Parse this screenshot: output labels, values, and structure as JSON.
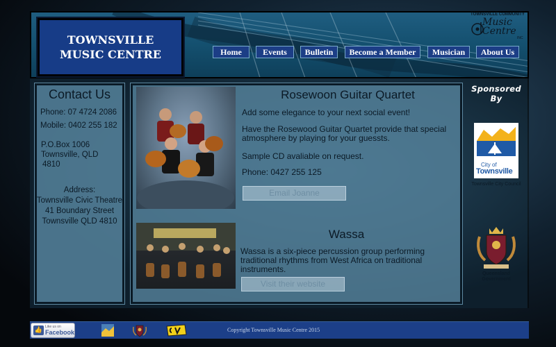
{
  "brand": {
    "site_title": "TOWNSVILLE MUSIC CENTRE",
    "logo_top": "TOWNSVILLE COMMUNITY",
    "logo_script_1": "Music",
    "logo_script_2": "Centre",
    "logo_inc": "INC"
  },
  "nav": {
    "items": [
      {
        "label": "Home"
      },
      {
        "label": "Events"
      },
      {
        "label": "Bulletin"
      },
      {
        "label": "Become a Member"
      },
      {
        "label": "Musician"
      },
      {
        "label": "About Us"
      }
    ]
  },
  "contact": {
    "title": "Contact Us",
    "phone": "Phone: 07 4724 2086",
    "mobile": "Mobile: 0402 255 182",
    "po_box_1": "P.O.Box 1006",
    "po_box_2": "Townsville, QLD",
    "po_box_3": "4810",
    "address_label": "Address:",
    "address_1": "Townsville Civic Theatre",
    "address_2": "41 Boundary Street",
    "address_3": "Townsville QLD 4810"
  },
  "quartet": {
    "title": "Rosewoon Guitar Quartet",
    "line_1": "Add some elegance to your next social event!",
    "line_2": "Have the Rosewood Guitar Quartet provide that special atmosphere by playing for your guessts.",
    "line_3": "Sample CD avaliable on request.",
    "phone": "Phone: 0427 255 125",
    "button": "Email Joanne"
  },
  "wassa": {
    "title": "Wassa",
    "description": "Wassa is a six-piece percussion group performing traditional rhythms from West Africa on traditional instruments.",
    "button": "Visit their website"
  },
  "sponsors": {
    "title": "Sponsored By",
    "tcc_city_of": "City of",
    "tcc_name": "Townsville",
    "tcc_caption": "Townsville City Council",
    "qld_caption_1": "Queensland",
    "qld_caption_2": "Government"
  },
  "footer": {
    "facebook_small": "Like us on",
    "facebook_big": "Facebook",
    "copyright": "Copyright Townsville Music Centre 2015"
  },
  "colors": {
    "header_blue": "#1f5d80",
    "logo_box": "#173c87",
    "nav_bg": "#1c3e86",
    "footer_bg": "#1c3f88",
    "panel_bg": "#5886a0"
  },
  "icons": [
    "facebook-like-icon",
    "partner-logo-icon",
    "crest-icon",
    "cv-logo-icon"
  ]
}
